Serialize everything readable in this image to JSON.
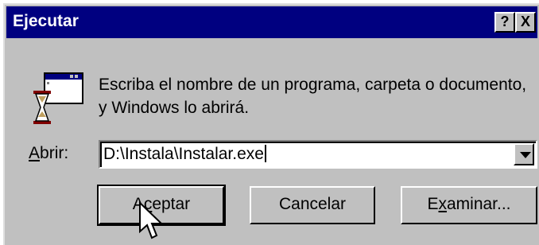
{
  "window": {
    "title": "Ejecutar",
    "help_button": "?",
    "close_button": "X"
  },
  "prompt": {
    "line1": "Escriba el nombre de un programa, carpeta o documento,",
    "line2": "y Windows lo abrirá."
  },
  "open_field": {
    "label_first": "A",
    "label_rest": "brir:",
    "value": "D:\\Instala\\Instalar.exe"
  },
  "buttons": {
    "accept_pre": "A",
    "accept_u": "c",
    "accept_post": "eptar",
    "cancel": "Cancelar",
    "browse_pre": "E",
    "browse_u": "x",
    "browse_post": "aminar..."
  },
  "colors": {
    "titlebar": "#000080",
    "face": "#c0c0c0"
  },
  "icons": [
    "run-icon",
    "dropdown-arrow-icon",
    "help-icon",
    "close-icon",
    "mouse-pointer-icon"
  ]
}
